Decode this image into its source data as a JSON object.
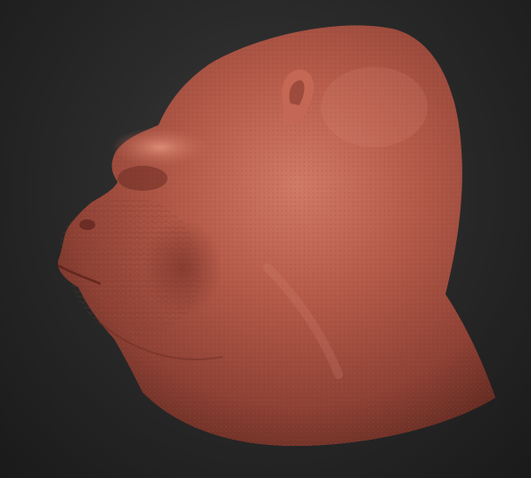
{
  "scene": {
    "subject": "gorilla-head-sculpt",
    "material_color": "#b35a4a",
    "background_color": "#2b2b2b"
  }
}
